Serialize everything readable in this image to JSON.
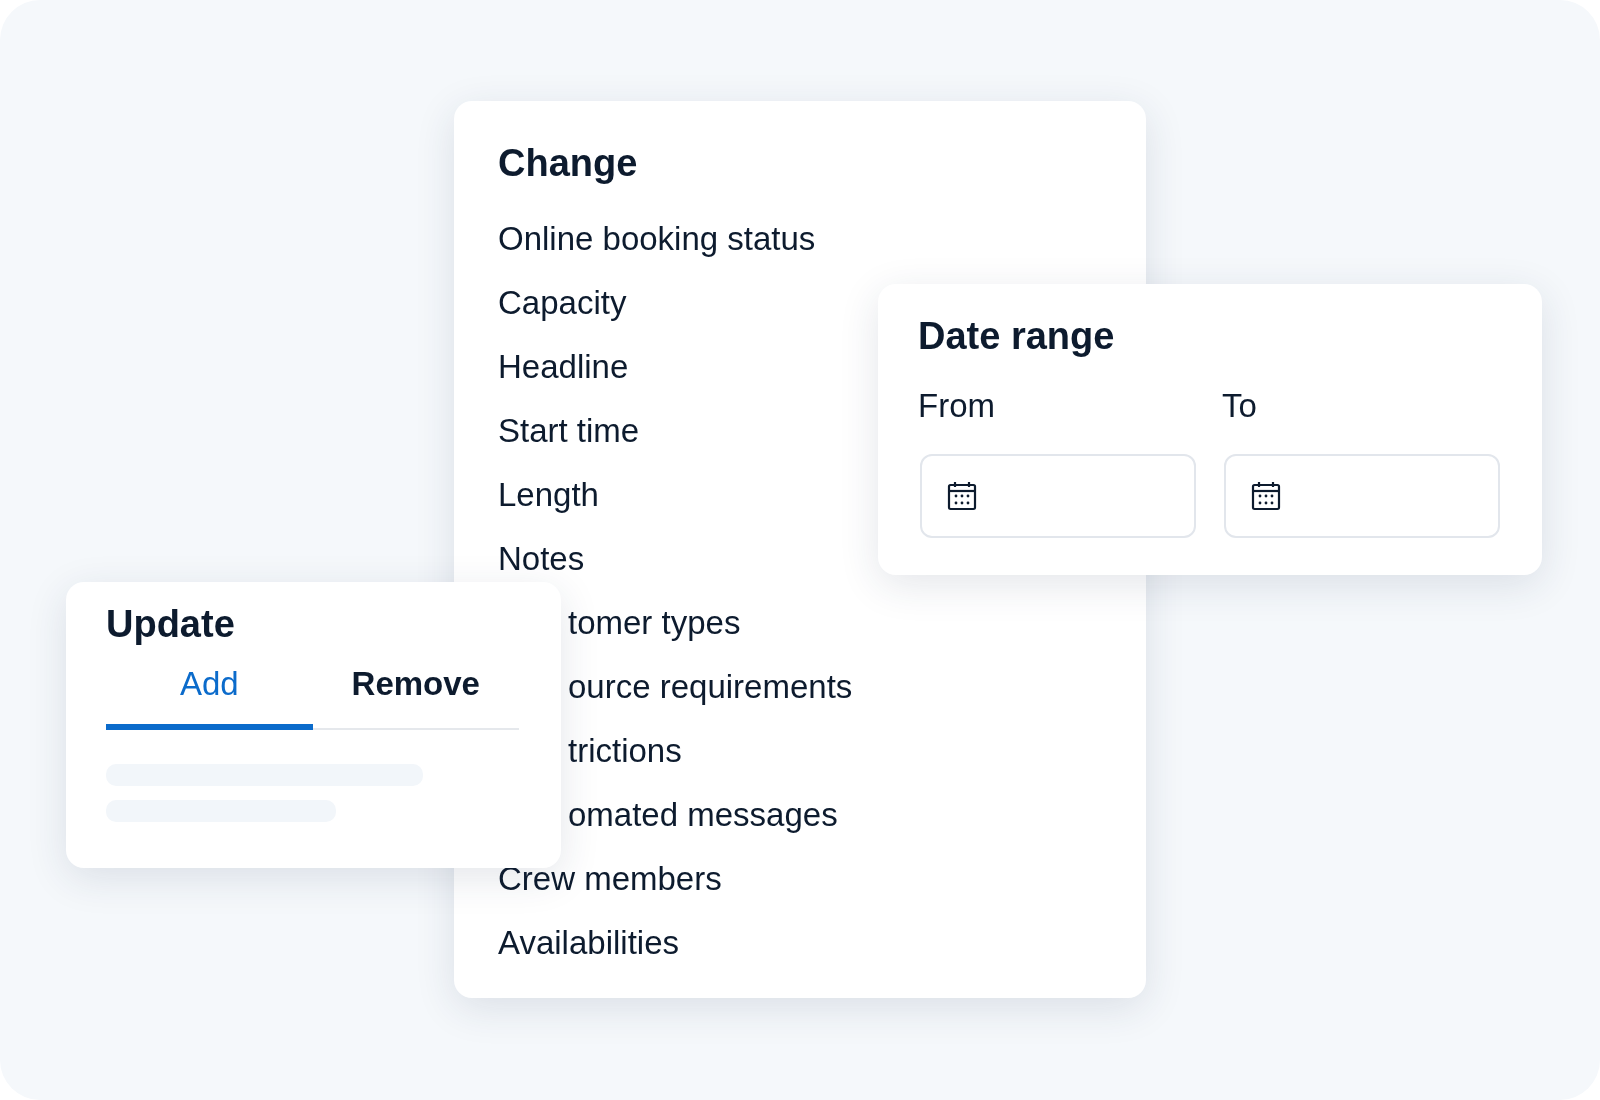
{
  "change": {
    "title": "Change",
    "items": [
      {
        "label": "Online booking status",
        "kind": "full"
      },
      {
        "label": "Capacity",
        "kind": "full"
      },
      {
        "label": "Headline",
        "kind": "full"
      },
      {
        "label": "Start time",
        "kind": "full"
      },
      {
        "label": "Length",
        "kind": "full"
      },
      {
        "label": "Notes",
        "kind": "full"
      },
      {
        "label": "tomer types",
        "kind": "clipped"
      },
      {
        "label": "ource requirements",
        "kind": "clipped"
      },
      {
        "label": "trictions",
        "kind": "clipped"
      },
      {
        "label": "omated messages",
        "kind": "clipped"
      },
      {
        "label": "Crew members",
        "kind": "full"
      },
      {
        "label": "Availabilities",
        "kind": "full"
      }
    ]
  },
  "date_range": {
    "title": "Date range",
    "fields": [
      {
        "label": "From"
      },
      {
        "label": "To"
      }
    ]
  },
  "update": {
    "title": "Update",
    "tabs": [
      {
        "label": "Add",
        "selected": true
      },
      {
        "label": "Remove",
        "selected": false
      }
    ]
  }
}
